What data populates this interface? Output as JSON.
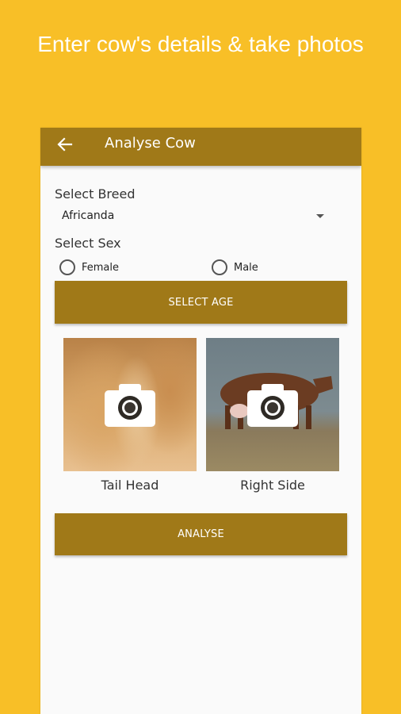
{
  "headline": "Enter cow's details & take photos",
  "appbar": {
    "title": "Analyse Cow",
    "back_icon": "arrow-left-icon"
  },
  "breed": {
    "label": "Select Breed",
    "value": "Africanda"
  },
  "sex": {
    "label": "Select Sex",
    "options": [
      "Female",
      "Male"
    ]
  },
  "select_age_label": "SELECT AGE",
  "photos": [
    {
      "caption": "Tail Head",
      "icon": "camera-icon"
    },
    {
      "caption": "Right Side",
      "icon": "camera-icon"
    }
  ],
  "analyse_label": "ANALYSE",
  "colors": {
    "background": "#F8BF27",
    "primary": "#A07918",
    "surface": "#FAFAFA"
  }
}
